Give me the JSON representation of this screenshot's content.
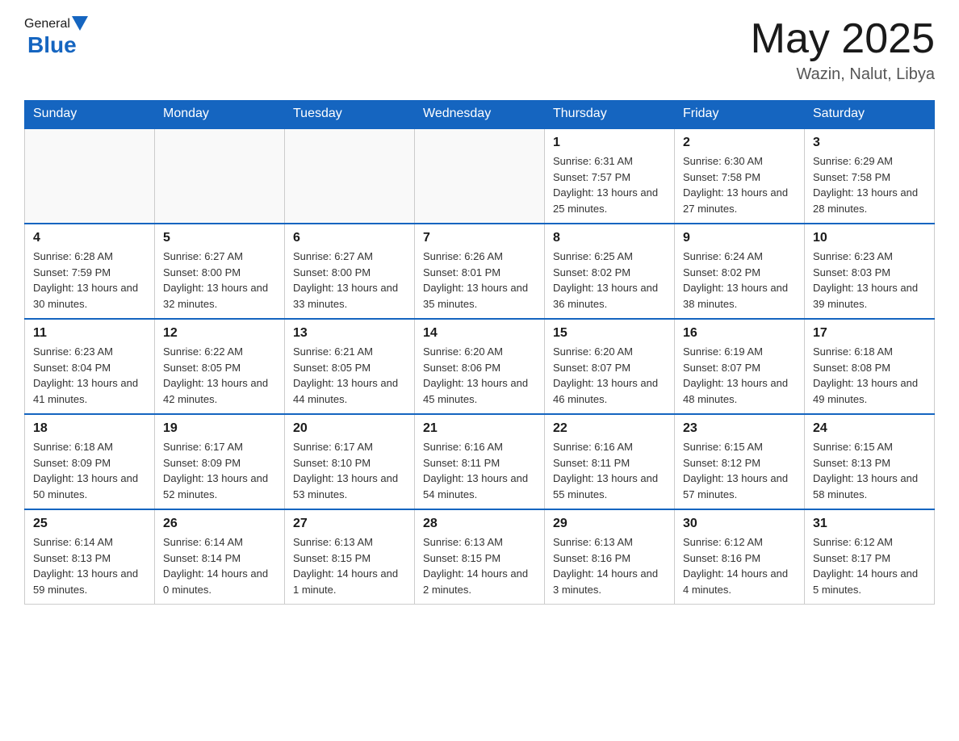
{
  "header": {
    "logo_general": "General",
    "logo_blue": "Blue",
    "month_year": "May 2025",
    "location": "Wazin, Nalut, Libya"
  },
  "days_of_week": [
    "Sunday",
    "Monday",
    "Tuesday",
    "Wednesday",
    "Thursday",
    "Friday",
    "Saturday"
  ],
  "weeks": [
    [
      {
        "day": "",
        "info": ""
      },
      {
        "day": "",
        "info": ""
      },
      {
        "day": "",
        "info": ""
      },
      {
        "day": "",
        "info": ""
      },
      {
        "day": "1",
        "info": "Sunrise: 6:31 AM\nSunset: 7:57 PM\nDaylight: 13 hours and 25 minutes."
      },
      {
        "day": "2",
        "info": "Sunrise: 6:30 AM\nSunset: 7:58 PM\nDaylight: 13 hours and 27 minutes."
      },
      {
        "day": "3",
        "info": "Sunrise: 6:29 AM\nSunset: 7:58 PM\nDaylight: 13 hours and 28 minutes."
      }
    ],
    [
      {
        "day": "4",
        "info": "Sunrise: 6:28 AM\nSunset: 7:59 PM\nDaylight: 13 hours and 30 minutes."
      },
      {
        "day": "5",
        "info": "Sunrise: 6:27 AM\nSunset: 8:00 PM\nDaylight: 13 hours and 32 minutes."
      },
      {
        "day": "6",
        "info": "Sunrise: 6:27 AM\nSunset: 8:00 PM\nDaylight: 13 hours and 33 minutes."
      },
      {
        "day": "7",
        "info": "Sunrise: 6:26 AM\nSunset: 8:01 PM\nDaylight: 13 hours and 35 minutes."
      },
      {
        "day": "8",
        "info": "Sunrise: 6:25 AM\nSunset: 8:02 PM\nDaylight: 13 hours and 36 minutes."
      },
      {
        "day": "9",
        "info": "Sunrise: 6:24 AM\nSunset: 8:02 PM\nDaylight: 13 hours and 38 minutes."
      },
      {
        "day": "10",
        "info": "Sunrise: 6:23 AM\nSunset: 8:03 PM\nDaylight: 13 hours and 39 minutes."
      }
    ],
    [
      {
        "day": "11",
        "info": "Sunrise: 6:23 AM\nSunset: 8:04 PM\nDaylight: 13 hours and 41 minutes."
      },
      {
        "day": "12",
        "info": "Sunrise: 6:22 AM\nSunset: 8:05 PM\nDaylight: 13 hours and 42 minutes."
      },
      {
        "day": "13",
        "info": "Sunrise: 6:21 AM\nSunset: 8:05 PM\nDaylight: 13 hours and 44 minutes."
      },
      {
        "day": "14",
        "info": "Sunrise: 6:20 AM\nSunset: 8:06 PM\nDaylight: 13 hours and 45 minutes."
      },
      {
        "day": "15",
        "info": "Sunrise: 6:20 AM\nSunset: 8:07 PM\nDaylight: 13 hours and 46 minutes."
      },
      {
        "day": "16",
        "info": "Sunrise: 6:19 AM\nSunset: 8:07 PM\nDaylight: 13 hours and 48 minutes."
      },
      {
        "day": "17",
        "info": "Sunrise: 6:18 AM\nSunset: 8:08 PM\nDaylight: 13 hours and 49 minutes."
      }
    ],
    [
      {
        "day": "18",
        "info": "Sunrise: 6:18 AM\nSunset: 8:09 PM\nDaylight: 13 hours and 50 minutes."
      },
      {
        "day": "19",
        "info": "Sunrise: 6:17 AM\nSunset: 8:09 PM\nDaylight: 13 hours and 52 minutes."
      },
      {
        "day": "20",
        "info": "Sunrise: 6:17 AM\nSunset: 8:10 PM\nDaylight: 13 hours and 53 minutes."
      },
      {
        "day": "21",
        "info": "Sunrise: 6:16 AM\nSunset: 8:11 PM\nDaylight: 13 hours and 54 minutes."
      },
      {
        "day": "22",
        "info": "Sunrise: 6:16 AM\nSunset: 8:11 PM\nDaylight: 13 hours and 55 minutes."
      },
      {
        "day": "23",
        "info": "Sunrise: 6:15 AM\nSunset: 8:12 PM\nDaylight: 13 hours and 57 minutes."
      },
      {
        "day": "24",
        "info": "Sunrise: 6:15 AM\nSunset: 8:13 PM\nDaylight: 13 hours and 58 minutes."
      }
    ],
    [
      {
        "day": "25",
        "info": "Sunrise: 6:14 AM\nSunset: 8:13 PM\nDaylight: 13 hours and 59 minutes."
      },
      {
        "day": "26",
        "info": "Sunrise: 6:14 AM\nSunset: 8:14 PM\nDaylight: 14 hours and 0 minutes."
      },
      {
        "day": "27",
        "info": "Sunrise: 6:13 AM\nSunset: 8:15 PM\nDaylight: 14 hours and 1 minute."
      },
      {
        "day": "28",
        "info": "Sunrise: 6:13 AM\nSunset: 8:15 PM\nDaylight: 14 hours and 2 minutes."
      },
      {
        "day": "29",
        "info": "Sunrise: 6:13 AM\nSunset: 8:16 PM\nDaylight: 14 hours and 3 minutes."
      },
      {
        "day": "30",
        "info": "Sunrise: 6:12 AM\nSunset: 8:16 PM\nDaylight: 14 hours and 4 minutes."
      },
      {
        "day": "31",
        "info": "Sunrise: 6:12 AM\nSunset: 8:17 PM\nDaylight: 14 hours and 5 minutes."
      }
    ]
  ]
}
